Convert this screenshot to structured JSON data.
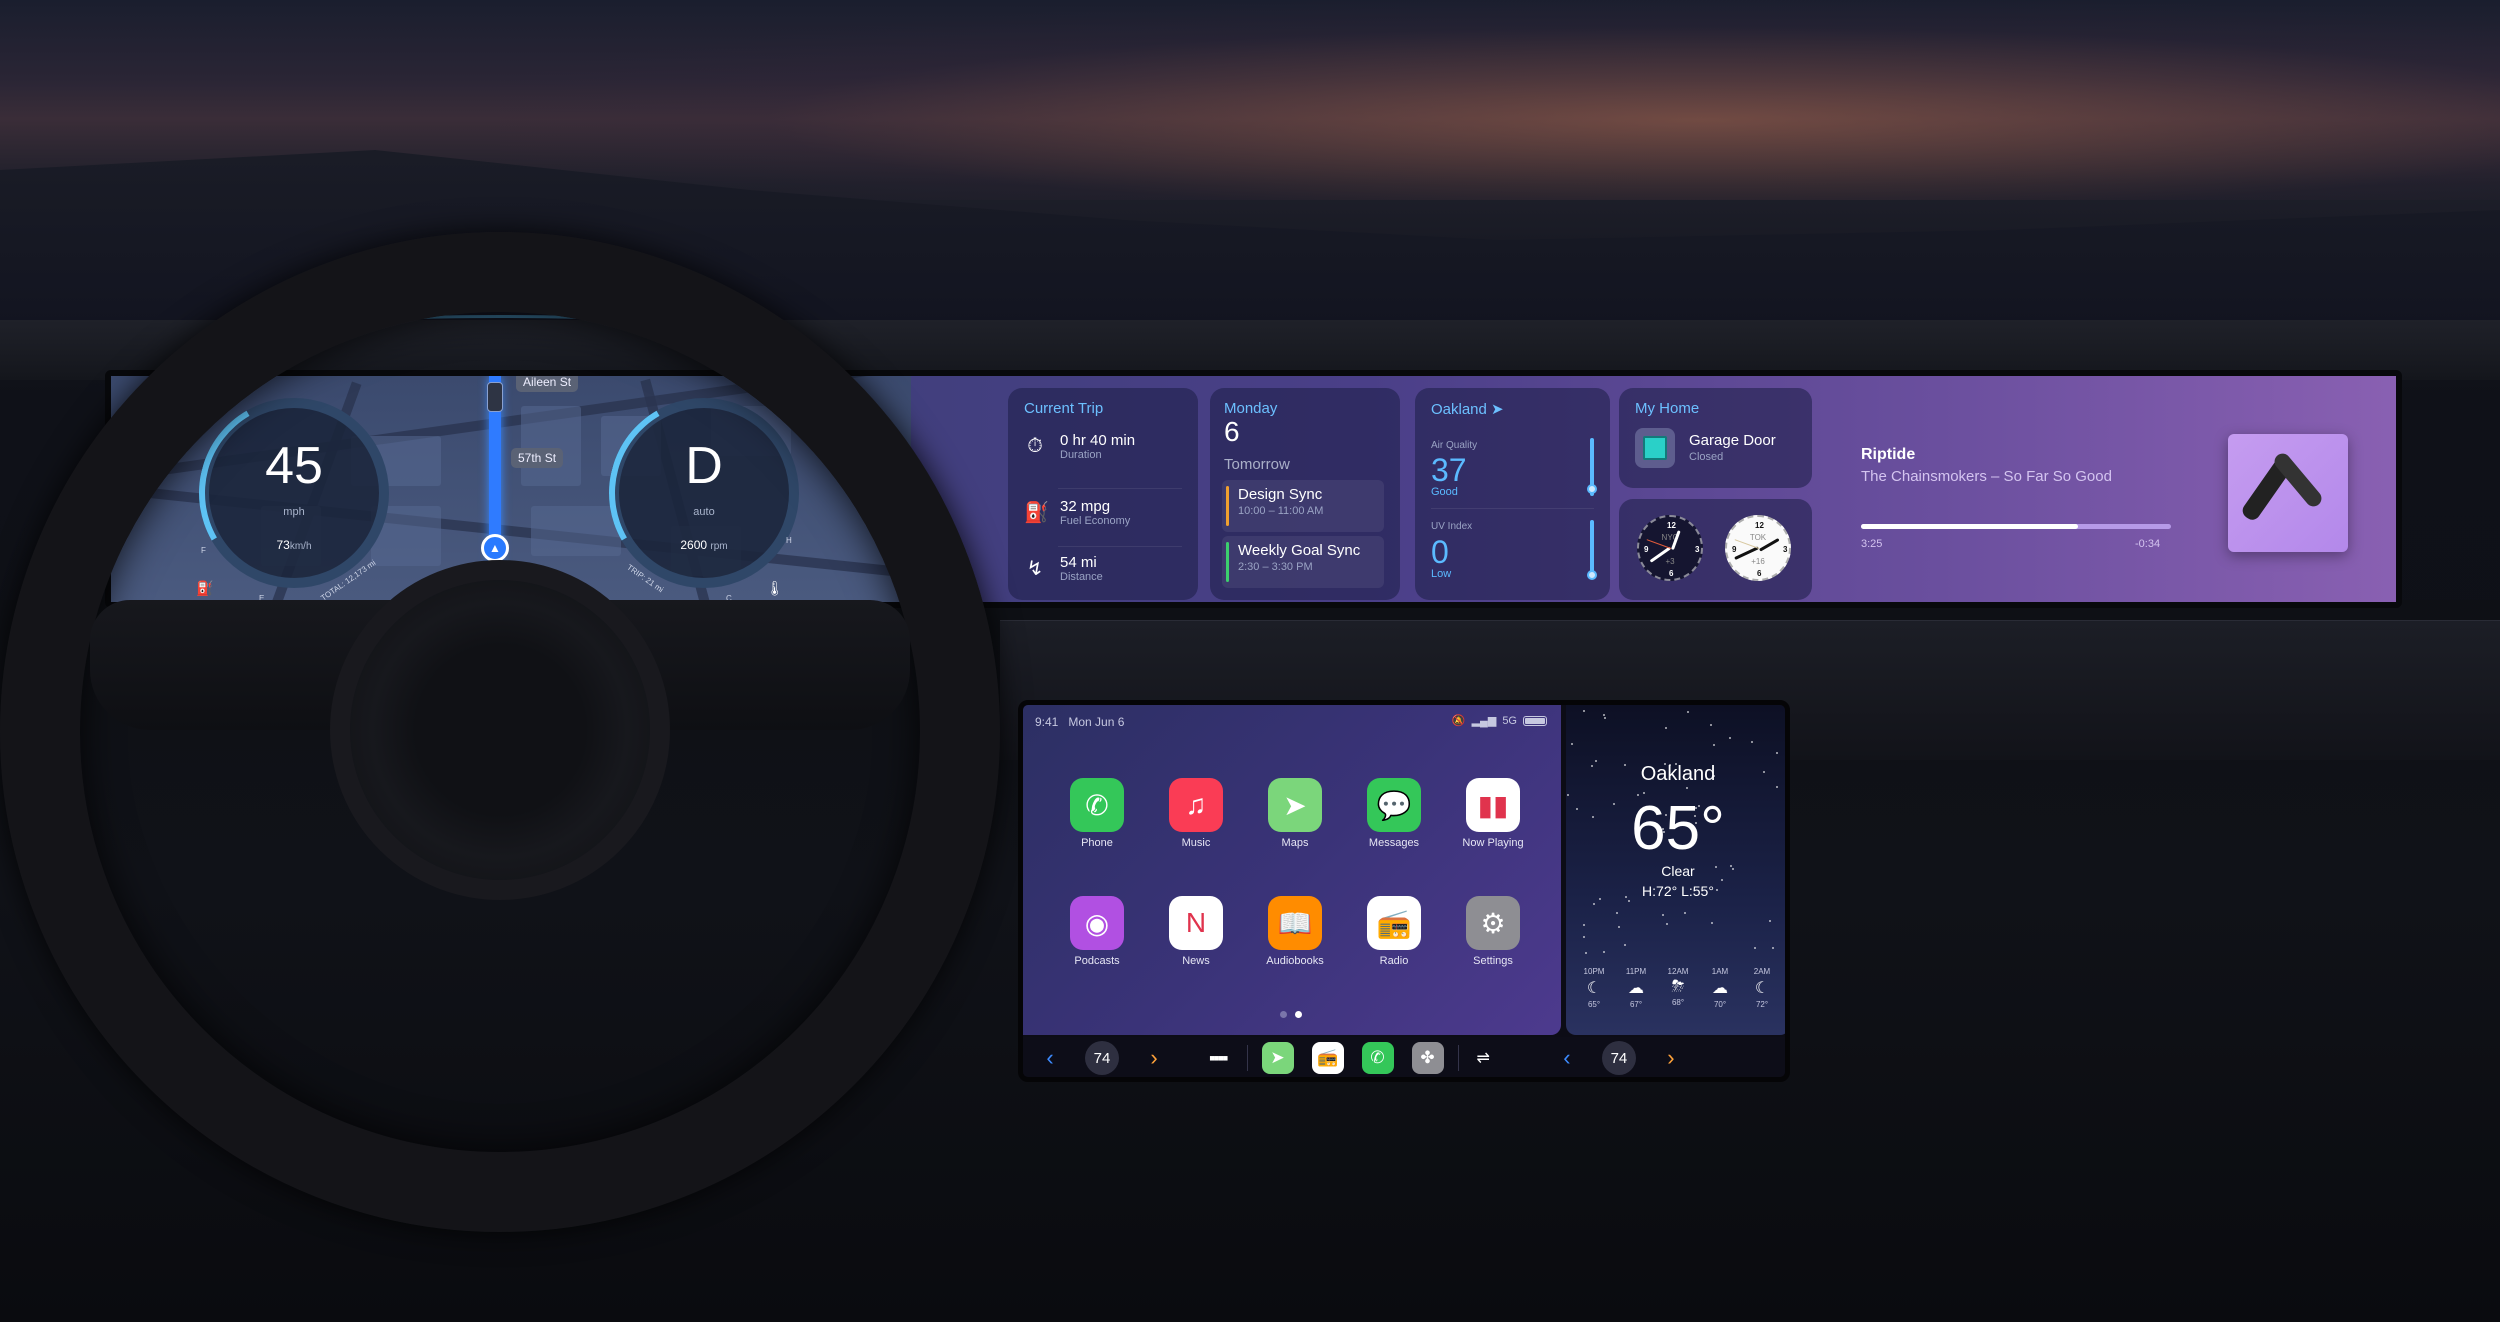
{
  "cluster": {
    "speed": "45",
    "speed_unit": "mph",
    "speed_kmh": "73",
    "kmh_unit": "km/h",
    "gear": "D",
    "gear_mode": "auto",
    "rpm": "2600",
    "rpm_unit": "rpm",
    "total_odometer": "TOTAL: 12,173 mi",
    "trip_odometer": "TRIP: 21 mi",
    "fuel_full_label": "F",
    "fuel_empty_label": "E",
    "temp_hot_label": "H",
    "temp_cold_label": "C",
    "streets": [
      "Aileen St",
      "57th St"
    ],
    "icons": {
      "fuel": "fuel-pump-icon",
      "coolant": "coolant-temp-icon",
      "nav": "navigation-arrow-icon",
      "traffic": "traffic-light-icon"
    }
  },
  "widgets": {
    "trip": {
      "title": "Current Trip",
      "rows": [
        {
          "icon": "stopwatch-icon",
          "value": "0 hr 40 min",
          "label": "Duration"
        },
        {
          "icon": "fuel-pump-icon",
          "value": "32 mpg",
          "label": "Fuel Economy"
        },
        {
          "icon": "route-icon",
          "value": "54 mi",
          "label": "Distance"
        }
      ]
    },
    "calendar": {
      "weekday": "Monday",
      "day": "6",
      "section": "Tomorrow",
      "events": [
        {
          "title": "Design Sync",
          "time": "10:00 – 11:00 AM",
          "color": "#f0a030"
        },
        {
          "title": "Weekly Goal Sync",
          "time": "2:30 – 3:30 PM",
          "color": "#3ccf6e"
        }
      ]
    },
    "air": {
      "city": "Oakland",
      "aq_label": "Air Quality",
      "aq_value": "37",
      "aq_desc": "Good",
      "aq_level": 0.2,
      "uv_label": "UV Index",
      "uv_value": "0",
      "uv_desc": "Low",
      "uv_level": 0.0
    },
    "home": {
      "title": "My Home",
      "device": "Garage Door",
      "state": "Closed"
    },
    "clocks": [
      {
        "city": "NYC",
        "offset": "+3",
        "theme": "dark"
      },
      {
        "city": "TOK",
        "offset": "+16",
        "theme": "light"
      }
    ],
    "now_playing": {
      "song": "Riptide",
      "artist_album": "The Chainsmokers – So Far So Good",
      "elapsed": "3:25",
      "remaining": "-0:34",
      "progress": 0.7
    }
  },
  "carplay": {
    "status": {
      "time": "9:41",
      "date": "Mon Jun 6",
      "network": "5G"
    },
    "apps": [
      {
        "name": "Phone",
        "icon": "phone-icon",
        "glyph": "✆",
        "bg": "#34c759"
      },
      {
        "name": "Music",
        "icon": "music-icon",
        "glyph": "♫",
        "bg": "#fa3c55"
      },
      {
        "name": "Maps",
        "icon": "maps-icon",
        "glyph": "➤",
        "bg": "#7bd67b"
      },
      {
        "name": "Messages",
        "icon": "messages-icon",
        "glyph": "💬",
        "bg": "#34c759"
      },
      {
        "name": "Now Playing",
        "icon": "now-playing-icon",
        "glyph": "▮▮",
        "bg": "#ffffff"
      },
      {
        "name": "Podcasts",
        "icon": "podcasts-icon",
        "glyph": "◉",
        "bg": "#b150e2"
      },
      {
        "name": "News",
        "icon": "news-icon",
        "glyph": "N",
        "bg": "#ffffff"
      },
      {
        "name": "Audiobooks",
        "icon": "audiobooks-icon",
        "glyph": "📖",
        "bg": "#ff8c00"
      },
      {
        "name": "Radio",
        "icon": "radio-icon",
        "glyph": "📻",
        "bg": "#ffffff"
      },
      {
        "name": "Settings",
        "icon": "settings-icon",
        "glyph": "⚙",
        "bg": "#8e8e93"
      }
    ],
    "page_count": 2,
    "current_page": 2,
    "weather": {
      "city": "Oakland",
      "temp": "65°",
      "condition": "Clear",
      "hi_lo": "H:72°  L:55°",
      "hourly": [
        {
          "hour": "10PM",
          "icon": "moon-stars-icon",
          "glyph": "☾",
          "temp": "65°"
        },
        {
          "hour": "11PM",
          "icon": "cloud-moon-rain-icon",
          "glyph": "☁",
          "temp": "67°"
        },
        {
          "hour": "12AM",
          "icon": "cloud-bolt-rain-icon",
          "glyph": "⛈",
          "temp": "68°"
        },
        {
          "hour": "1AM",
          "icon": "cloud-moon-icon",
          "glyph": "☁",
          "temp": "70°"
        },
        {
          "hour": "2AM",
          "icon": "moon-stars-icon",
          "glyph": "☾",
          "temp": "72°"
        }
      ]
    },
    "dock": {
      "left_temp": "74",
      "right_temp": "74",
      "apps": [
        {
          "name": "Maps",
          "icon": "maps-icon",
          "glyph": "➤",
          "bg": "#7bd67b"
        },
        {
          "name": "Radio",
          "icon": "radio-icon",
          "glyph": "📻",
          "bg": "#ffffff"
        },
        {
          "name": "Phone",
          "icon": "phone-icon",
          "glyph": "✆",
          "bg": "#34c759"
        },
        {
          "name": "Climate",
          "icon": "fan-icon",
          "glyph": "✤",
          "bg": "#8e8e93"
        }
      ]
    }
  },
  "colors": {
    "accent": "#6cc0ff",
    "route": "#2f7bff",
    "left_chevron": "#3d8bff",
    "right_chevron": "#ffa23a"
  }
}
